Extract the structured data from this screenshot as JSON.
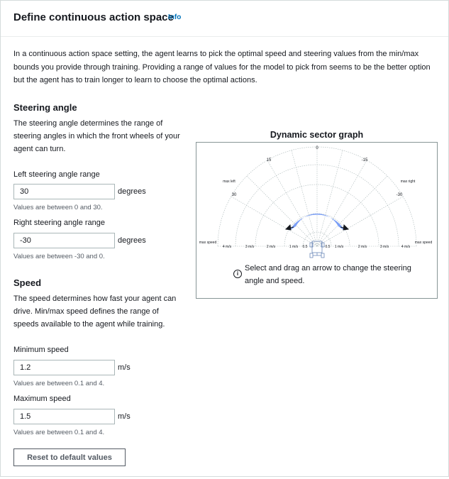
{
  "header": {
    "title": "Define continuous action space",
    "info_link": "Info"
  },
  "intro": "In a continuous action space setting, the agent learns to pick the optimal speed and steering values from the min/max bounds you provide through training. Providing a range of values for the model to pick from seems to be the better option but the agent has to train longer to learn to choose the optimal actions.",
  "steering": {
    "heading": "Steering angle",
    "description": "The steering angle determines the range of steering angles in which the front wheels of your agent can turn.",
    "left": {
      "label": "Left steering angle range",
      "value": "30",
      "unit": "degrees",
      "hint": "Values are between 0 and 30."
    },
    "right": {
      "label": "Right steering angle range",
      "value": "-30",
      "unit": "degrees",
      "hint": "Values are between -30 and 0."
    }
  },
  "speed": {
    "heading": "Speed",
    "description": "The speed determines how fast your agent can drive. Min/max speed defines the range of speeds available to the agent while training.",
    "min": {
      "label": "Minimum speed",
      "value": "1.2",
      "unit": "m/s",
      "hint": "Values are between 0.1 and 4."
    },
    "max": {
      "label": "Maximum speed",
      "value": "1.5",
      "unit": "m/s",
      "hint": "Values are between 0.1 and 4."
    }
  },
  "reset_button": "Reset to default values",
  "graph": {
    "title": "Dynamic sector graph",
    "angle_labels": {
      "top": "0",
      "left": "15",
      "right": "-15",
      "left_inner": "30",
      "right_inner": "-30"
    },
    "max_left": "max left",
    "max_right": "max right",
    "max_speed": "max speed",
    "speed_labels_left": [
      "4 m/s",
      "3 m/s",
      "2 m/s",
      "1 m/s",
      "0.5"
    ],
    "speed_labels_right": [
      "0.5",
      "1 m/s",
      "2 m/s",
      "3 m/s",
      "4 m/s"
    ],
    "hint_icon": "info-icon",
    "hint": "Select and drag an arrow to change the steering angle and speed.",
    "accent": "#7a9ef5"
  }
}
